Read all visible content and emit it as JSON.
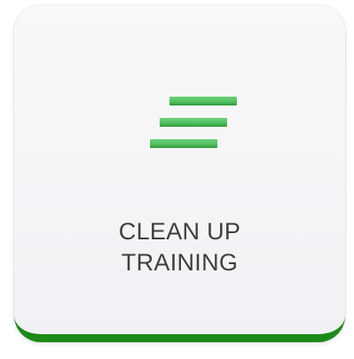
{
  "tile": {
    "label_line1": "CLEAN UP",
    "label_line2": "TRAINING",
    "icon": "list-lines-icon",
    "accent_color": "#1c8a17",
    "icon_color": "#54c262"
  }
}
